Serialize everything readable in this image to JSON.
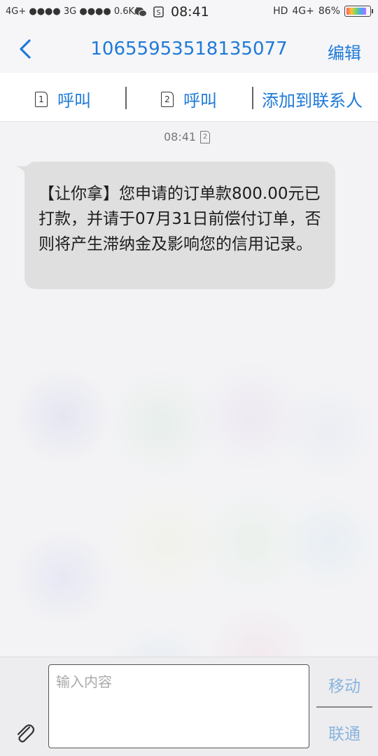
{
  "status_bar": {
    "left": "4G+ ●●●● 3G ●●●● 0.6K/s",
    "time": "08:41",
    "hd": "HD",
    "network": "4G+",
    "battery": "86%",
    "battery_level": 0.86
  },
  "header": {
    "title": "10655953518135077",
    "edit_label": "编辑"
  },
  "actions": {
    "call1_label": "呼叫",
    "sim1": "1",
    "call2_label": "呼叫",
    "sim2": "2",
    "add_contact_label": "添加到联系人"
  },
  "message": {
    "time": "08:41",
    "sim": "2",
    "text": "【让你拿】您申请的订单款800.00元已打款，并请于07月31日前偿付订单，否则将产生滞纳金及影响您的信用记录。"
  },
  "composer": {
    "placeholder": "输入内容",
    "send_sim1_label": "移动",
    "send_sim2_label": "联通"
  },
  "colors": {
    "accent": "#1f7ad8",
    "bubble": "#dfdfe0"
  }
}
